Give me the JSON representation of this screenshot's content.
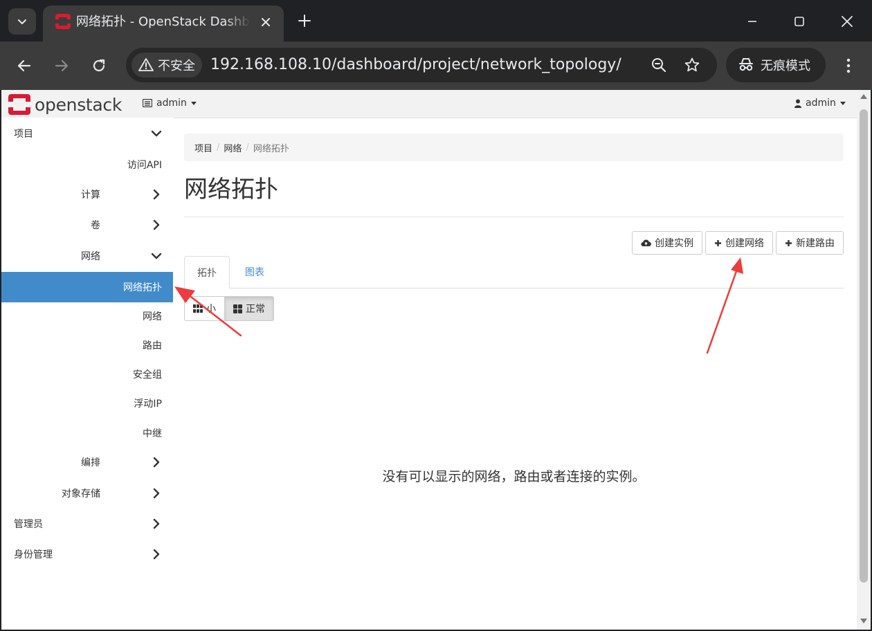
{
  "browser": {
    "tab_title": "网络拓扑 - OpenStack Dashboard",
    "security_label": "不安全",
    "url": "192.168.108.10/dashboard/project/network_topology/",
    "incognito_label": "无痕模式"
  },
  "header": {
    "logo_text": "openstack",
    "project_label": "admin",
    "user_label": "admin"
  },
  "sidebar": {
    "items": [
      {
        "label": "项目"
      },
      {
        "label": "访问API"
      },
      {
        "label": "计算"
      },
      {
        "label": "卷"
      },
      {
        "label": "网络"
      },
      {
        "label": "网络拓扑"
      },
      {
        "label": "网络"
      },
      {
        "label": "路由"
      },
      {
        "label": "安全组"
      },
      {
        "label": "浮动IP"
      },
      {
        "label": "中继"
      },
      {
        "label": "编排"
      },
      {
        "label": "对象存储"
      },
      {
        "label": "管理员"
      },
      {
        "label": "身份管理"
      }
    ]
  },
  "main": {
    "breadcrumb": [
      "项目",
      "网络",
      "网络拓扑"
    ],
    "title": "网络拓扑",
    "actions": {
      "create_instance": "创建实例",
      "create_network": "创建网络",
      "create_router": "新建路由"
    },
    "tabs": [
      "拓扑",
      "图表"
    ],
    "size_buttons": [
      "小",
      "正常"
    ],
    "empty_message": "没有可以显示的网络，路由或者连接的实例。"
  },
  "colors": {
    "active_nav": "#428bca",
    "openstack_red": "#da1a32",
    "annotation_arrow": "#ee3b3b"
  }
}
